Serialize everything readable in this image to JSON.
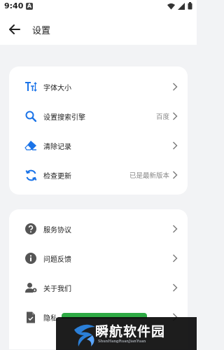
{
  "status_bar": {
    "time": "9:40",
    "notification_letter": "A"
  },
  "app_bar": {
    "title": "设置"
  },
  "group1": [
    {
      "label": "字体大小",
      "value": "",
      "icon": "font-size-icon"
    },
    {
      "label": "设置搜索引擎",
      "value": "百度",
      "icon": "search-icon"
    },
    {
      "label": "清除记录",
      "value": "",
      "icon": "eraser-icon"
    },
    {
      "label": "检查更新",
      "value": "已是最新版本",
      "icon": "refresh-icon"
    }
  ],
  "group2": [
    {
      "label": "服务协议",
      "value": "",
      "icon": "question-circle-icon"
    },
    {
      "label": "问题反馈",
      "value": "",
      "icon": "info-circle-icon"
    },
    {
      "label": "关于我们",
      "value": "",
      "icon": "user-icon"
    },
    {
      "label": "隐私",
      "value": "",
      "icon": "document-icon"
    }
  ],
  "watermark": {
    "title": "瞬航软件园",
    "subtitle": "ShunHangRuanJianYuan"
  },
  "colors": {
    "accent": "#1a73e8",
    "icon_dark": "#555555",
    "background": "#f2f3f5",
    "card": "#ffffff"
  }
}
